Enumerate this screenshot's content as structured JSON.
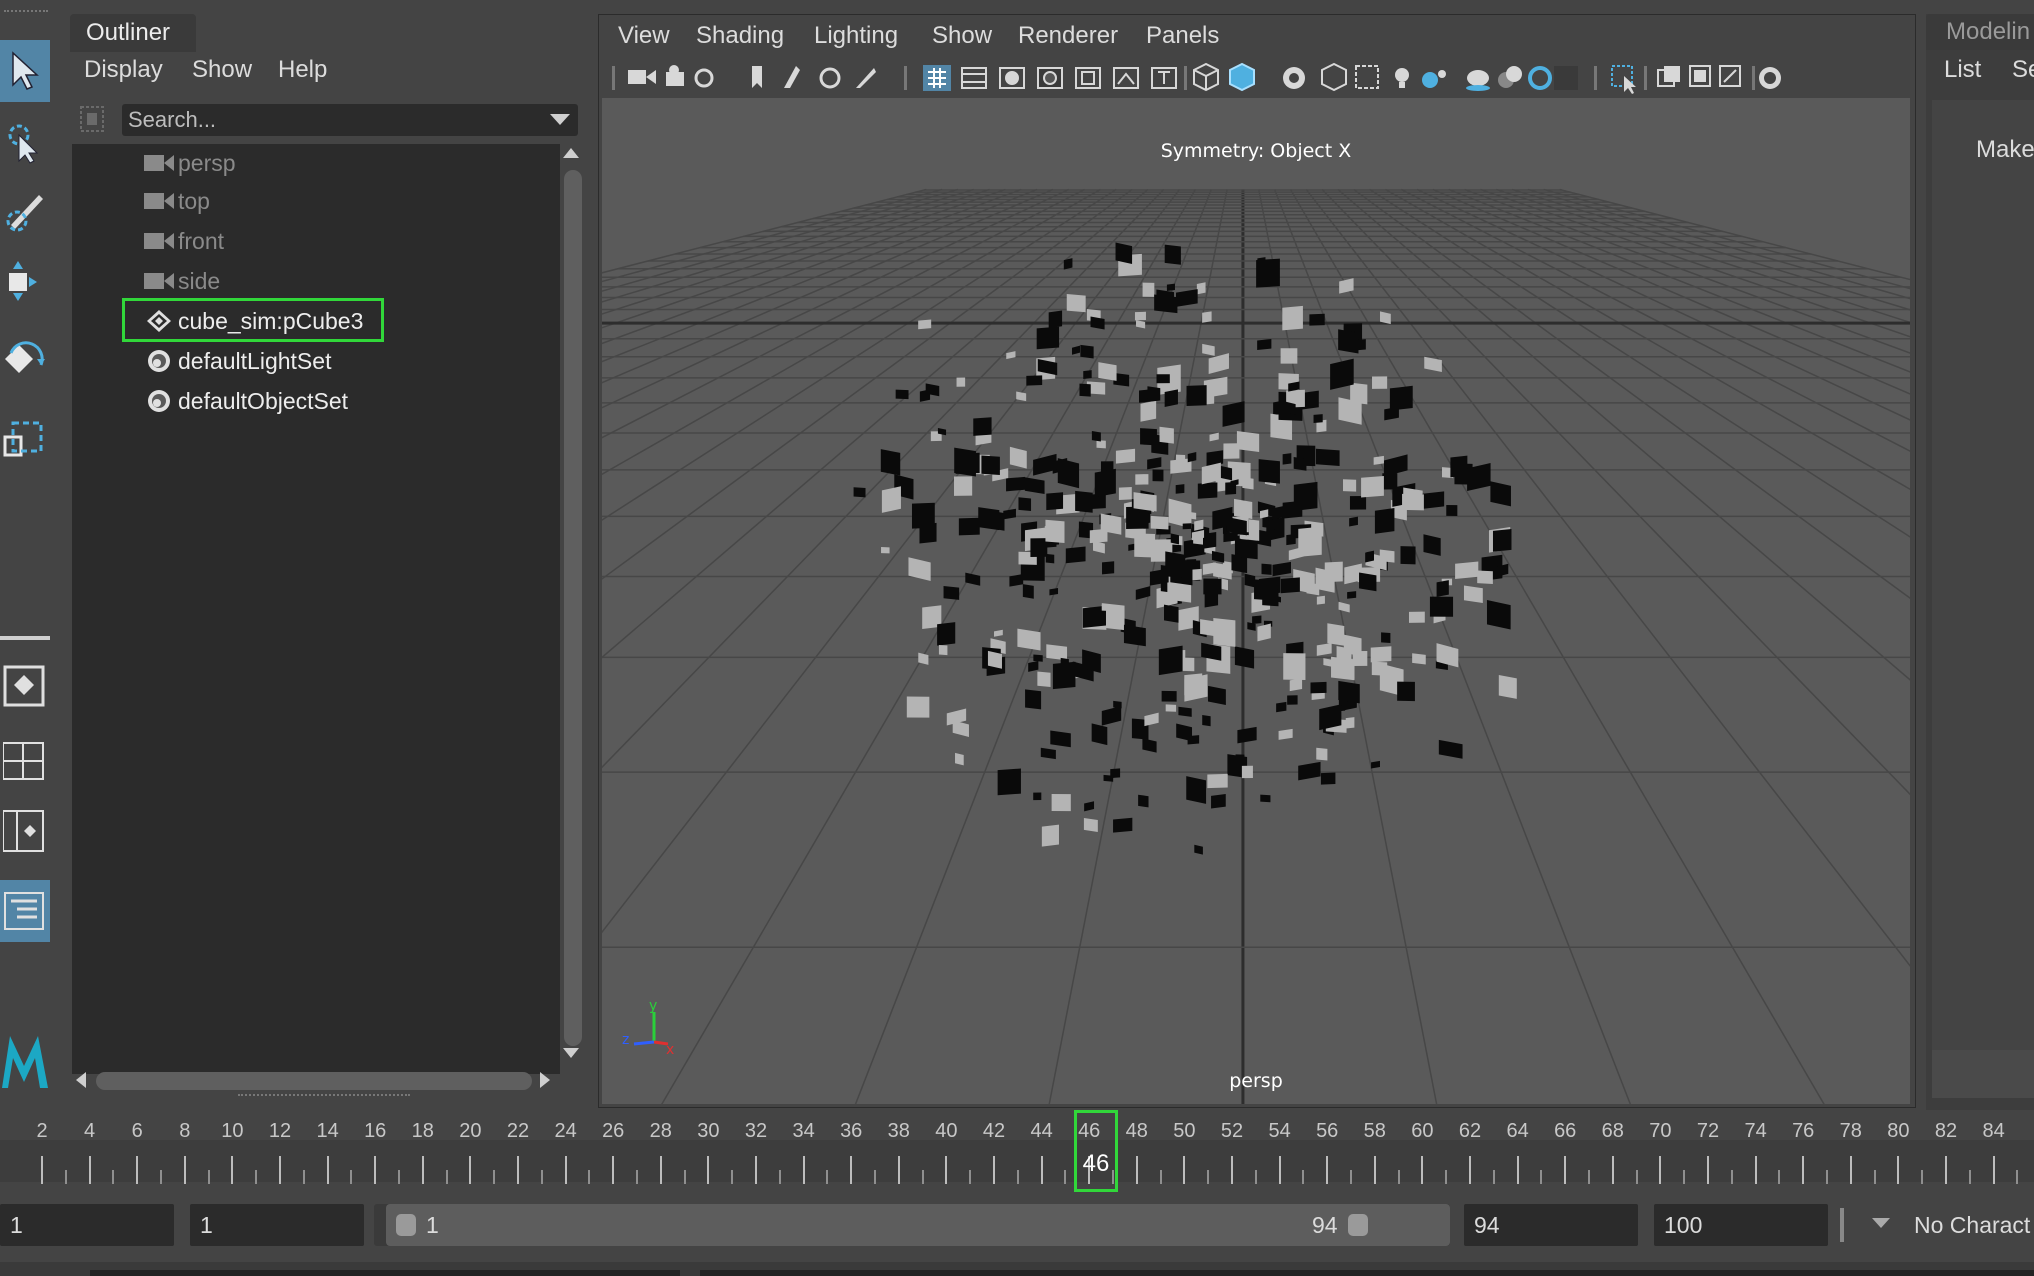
{
  "outliner": {
    "tab_title": "Outliner",
    "menu": [
      "Display",
      "Show",
      "Help"
    ],
    "search_placeholder": "Search...",
    "items": [
      {
        "label": "persp",
        "icon": "camera-icon",
        "dim": true
      },
      {
        "label": "top",
        "icon": "camera-icon",
        "dim": true
      },
      {
        "label": "front",
        "icon": "camera-icon",
        "dim": true
      },
      {
        "label": "side",
        "icon": "camera-icon",
        "dim": true
      },
      {
        "label": "cube_sim:pCube3",
        "icon": "mesh-icon",
        "dim": false,
        "selected": true
      },
      {
        "label": "defaultLightSet",
        "icon": "set-icon",
        "dim": false
      },
      {
        "label": "defaultObjectSet",
        "icon": "set-icon",
        "dim": false
      }
    ]
  },
  "viewport": {
    "menu": [
      "View",
      "Shading",
      "Lighting",
      "Show",
      "Renderer",
      "Panels"
    ],
    "symmetry_label": "Symmetry: Object X",
    "camera_label": "persp",
    "axis_labels": {
      "y": "y",
      "z": "z",
      "x": "x"
    }
  },
  "right_panel": {
    "title": "Modelin",
    "menu": [
      "List",
      "Se"
    ],
    "button": "Make"
  },
  "timeline": {
    "ticks": [
      "2",
      "4",
      "6",
      "8",
      "10",
      "12",
      "14",
      "16",
      "18",
      "20",
      "22",
      "24",
      "26",
      "28",
      "30",
      "32",
      "34",
      "36",
      "38",
      "40",
      "42",
      "44",
      "46",
      "48",
      "50",
      "52",
      "54",
      "56",
      "58",
      "60",
      "62",
      "64",
      "66",
      "68",
      "70",
      "72",
      "74",
      "76",
      "78",
      "80",
      "82",
      "84"
    ],
    "current_frame": "46"
  },
  "range": {
    "start_time": "1",
    "playback_start": "1",
    "slider_start": "1",
    "slider_end": "94",
    "playback_end": "94",
    "end_time": "100",
    "character_set": "No Charact"
  },
  "colors": {
    "highlight": "#31d73a",
    "active_tool": "#5285a6",
    "panel_dark": "#2b2b2b",
    "viewport_bg": "#5a5a5a"
  }
}
